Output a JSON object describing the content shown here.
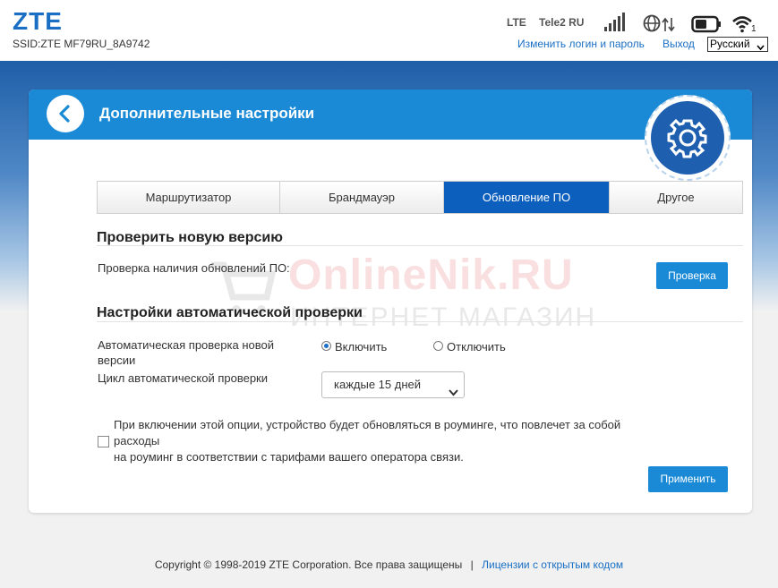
{
  "header": {
    "logo": "ZTE",
    "ssid": "SSID:ZTE MF79RU_8A9742",
    "network_type": "LTE",
    "operator": "Tele2 RU",
    "change_login_link": "Изменить логин и пароль",
    "logout_link": "Выход",
    "language": "Русский",
    "wifi_clients": "1"
  },
  "card": {
    "title": "Дополнительные настройки",
    "tabs": [
      {
        "label": "Маршрутизатор",
        "active": false
      },
      {
        "label": "Брандмауэр",
        "active": false
      },
      {
        "label": "Обновление ПО",
        "active": true
      },
      {
        "label": "Другое",
        "active": false
      }
    ],
    "check_section": {
      "title": "Проверить новую версию",
      "label": "Проверка наличия обновлений ПО:",
      "button": "Проверка"
    },
    "auto_section": {
      "title": "Настройки автоматической проверки",
      "auto_check_label_line1": "Автоматическая проверка новой",
      "auto_check_label_line2": "версии",
      "radio_on": "Включить",
      "radio_off": "Отключить",
      "radio_selected": "on",
      "cycle_label": "Цикл автоматической проверки",
      "cycle_value": "каждые 15 дней",
      "roaming_notice_line1": "При включении этой опции, устройство будет обновляться в роуминге, что повлечет за собой расходы",
      "roaming_notice_line2": "на роуминг в соответствии с тарифами вашего оператора связи.",
      "roaming_checked": false,
      "apply_button": "Применить"
    }
  },
  "watermark": {
    "main": "OnlineNik.RU",
    "sub": "ИНТЕРНЕТ МАГАЗИН"
  },
  "footer": {
    "copyright": "Copyright © 1998-2019 ZTE Corporation. Все права защищены",
    "separator": "|",
    "license_link": "Лицензии с открытым кодом"
  },
  "colors": {
    "accent": "#1b8ad6",
    "active_tab": "#0d5fbd",
    "link": "#1a6fc4",
    "gear_circle": "#1f5fb0"
  },
  "icons": [
    "back-icon",
    "gear-icon",
    "signal-bars-icon",
    "roaming-globe-icon",
    "battery-icon",
    "wifi-icon"
  ]
}
